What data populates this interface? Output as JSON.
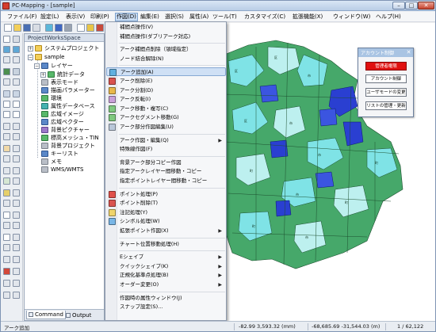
{
  "window": {
    "title": "PC-Mapping - [sample]",
    "min_glyph": "–",
    "max_glyph": "□",
    "close_glyph": "✕"
  },
  "menubar": {
    "items": [
      {
        "label": "ファイル(F)"
      },
      {
        "label": "設定(L)"
      },
      {
        "label": "表示(V)"
      },
      {
        "label": "印刷(P)"
      },
      {
        "label": "作図(D)",
        "active": true
      },
      {
        "label": "編集(E)"
      },
      {
        "label": "選択(S)"
      },
      {
        "label": "属性(A)"
      },
      {
        "label": "ツール(T)"
      },
      {
        "label": "カスタマイズ(C)"
      },
      {
        "label": "拡張機能(X)"
      },
      {
        "label": "ウィンドウ(W)"
      },
      {
        "label": "ヘルプ(H)"
      }
    ]
  },
  "panel": {
    "title": "ProjectWorksSpace",
    "tree": [
      {
        "label": "システムプロジェクト",
        "icon": "folder-icon",
        "expander": "+"
      },
      {
        "label": "sample",
        "icon": "folder-icon",
        "expander": "−"
      },
      {
        "label": "レイヤー",
        "icon": "blue-layer-icon",
        "expander": "−"
      },
      {
        "label": "統計データ",
        "icon": "green-data-icon",
        "expander": "+"
      },
      {
        "label": "表示モード",
        "icon": "gray-mode-icon"
      },
      {
        "label": "描画パラメーター",
        "icon": "blue-param-icon"
      },
      {
        "label": "環境",
        "icon": "green-env-icon"
      },
      {
        "label": "属性データベース",
        "icon": "teal-db-icon"
      },
      {
        "label": "広域イメージ",
        "icon": "green-image-icon"
      },
      {
        "label": "広域ベクター",
        "icon": "blue-vector-icon"
      },
      {
        "label": "背景ピクチャー",
        "icon": "purple-picture-icon"
      },
      {
        "label": "標高メッシュ・TIN",
        "icon": "green-mesh-icon"
      },
      {
        "label": "背景プロジェクト",
        "icon": "gray-project-icon"
      },
      {
        "label": "キーリスト",
        "icon": "blue-keylist-icon"
      },
      {
        "label": "メモ",
        "icon": "gray-memo-icon"
      },
      {
        "label": "WMS/WMTS",
        "icon": "gray-wms-icon"
      }
    ],
    "tabs": [
      {
        "label": "Command",
        "active": true
      },
      {
        "label": "Output",
        "active": false
      }
    ]
  },
  "dropdown": {
    "items": [
      {
        "label": "補間点操作(V)",
        "icon": "none"
      },
      {
        "label": "補間点操作(ダブリアーク対応)",
        "icon": "none"
      },
      {
        "type": "sep"
      },
      {
        "label": "アーク補間点削除（領域指定）",
        "icon": "none"
      },
      {
        "label": "ノード結合解除(N)",
        "icon": "none"
      },
      {
        "type": "sep"
      },
      {
        "label": "アーク追加(A)",
        "icon": "arc-add-icon",
        "highlight": true
      },
      {
        "label": "アーク削除(E)",
        "icon": "arc-delete-icon"
      },
      {
        "label": "アーク分割(D)",
        "icon": "arc-split-icon"
      },
      {
        "label": "アーク反転(I)",
        "icon": "arc-reverse-icon"
      },
      {
        "label": "アーク移動・複写(C)",
        "icon": "arc-move-icon"
      },
      {
        "label": "アークセグメント移動(G)",
        "icon": "arc-segment-icon"
      },
      {
        "label": "アーク部分作図編集(U)",
        "icon": "arc-partial-icon"
      },
      {
        "type": "sep"
      },
      {
        "label": "アーク作図・編集(Q)",
        "icon": "none",
        "submenu": true
      },
      {
        "label": "特殊線作図(F)",
        "icon": "none"
      },
      {
        "type": "sep"
      },
      {
        "label": "背景アーク部分コピー作図",
        "icon": "none"
      },
      {
        "label": "指定アークレイヤー間移動・コピー",
        "icon": "none"
      },
      {
        "label": "指定ポイントレイヤー間移動・コピー",
        "icon": "none"
      },
      {
        "type": "sep"
      },
      {
        "label": "ポイント処理(P)",
        "icon": "point-process-icon"
      },
      {
        "label": "ポイント削除(T)",
        "icon": "point-delete-icon"
      },
      {
        "label": "注記処理(Y)",
        "icon": "annotation-icon"
      },
      {
        "label": "シンボル処理(W)",
        "icon": "symbol-icon"
      },
      {
        "label": "拡張ポイント作図(X)",
        "icon": "none",
        "submenu": true
      },
      {
        "type": "sep"
      },
      {
        "label": "チャート位置移動処理(H)",
        "icon": "none"
      },
      {
        "type": "sep"
      },
      {
        "label": "Eシェイプ",
        "icon": "none",
        "submenu": true
      },
      {
        "label": "クイックシェイプ(K)",
        "icon": "none",
        "submenu": true
      },
      {
        "label": "正規化基準点処理(B)",
        "icon": "none",
        "submenu": true
      },
      {
        "label": "オーダー変更(O)",
        "icon": "none",
        "submenu": true
      },
      {
        "type": "sep"
      },
      {
        "label": "作図時の属性ウィンドウ(J)",
        "icon": "none"
      },
      {
        "label": "スナップ設定(S)...",
        "icon": "none"
      }
    ]
  },
  "account_panel": {
    "title": "アカウント制御",
    "close_glyph": "✕",
    "buttons": [
      {
        "label": "管理者権限",
        "style": "red"
      },
      {
        "label": "アカウント制御",
        "style": "normal"
      },
      {
        "label": "ユーザモードの変更",
        "style": "normal"
      },
      {
        "label": "リストの管理・更新",
        "style": "normal"
      }
    ]
  },
  "status": {
    "mode": "アーク追加",
    "cursor": "-82.99  3,593.32 (mm)",
    "map_coord": "-68,685.69  -31,544.03 (m)",
    "scale": "1 / 62,122"
  },
  "colors": {
    "map_land": "#46a86a",
    "map_cyan": "#7fe3e6",
    "map_blue": "#2a3fd1",
    "map_light": "#bdf0ef",
    "menu_highlight": "#cfe0f5"
  }
}
